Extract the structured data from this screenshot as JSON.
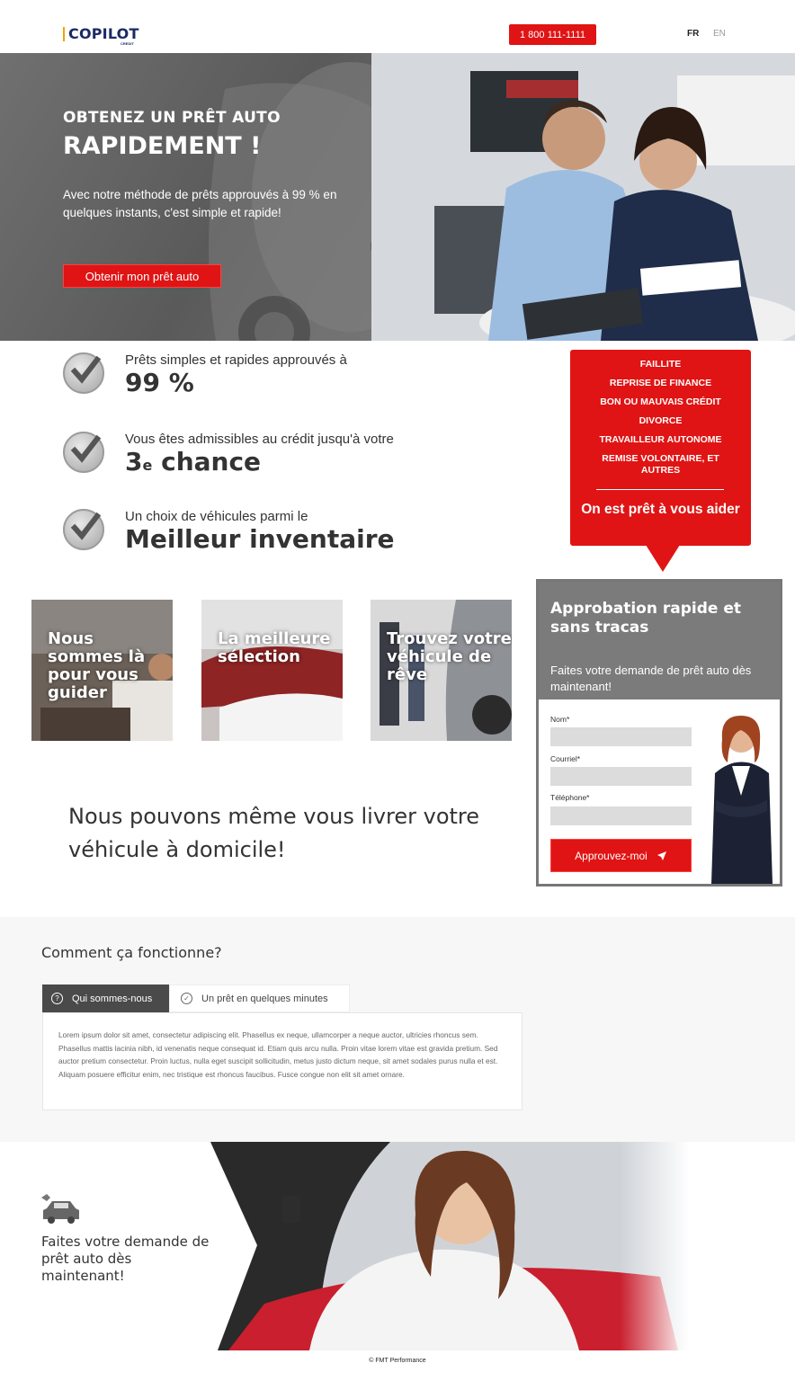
{
  "header": {
    "logo_text": "COPILOT",
    "logo_sub": "CREDIT",
    "phone": "1 800 111-1111",
    "lang_fr": "FR",
    "lang_en": "EN"
  },
  "hero": {
    "kicker": "OBTENEZ UN PRÊT AUTO",
    "title": "RAPIDEMENT !",
    "description": "Avec notre méthode de prêts approuvés à 99 % en quelques instants, c'est simple et rapide!",
    "cta": "Obtenir mon prêt auto"
  },
  "features": [
    {
      "small": "Prêts simples et rapides approuvés à",
      "big": "99 %"
    },
    {
      "small": "Vous êtes admissibles au crédit jusqu'à votre",
      "big_main": "3",
      "big_sup": "e",
      "big_rest": " chance"
    },
    {
      "small": "Un choix de véhicules parmi le",
      "big": "Meilleur inventaire"
    }
  ],
  "situations": {
    "items": [
      "FAILLITE",
      "REPRISE DE FINANCE",
      "BON OU MAUVAIS CRÉDIT",
      "DIVORCE",
      "TRAVAILLEUR AUTONOME",
      "REMISE VOLONTAIRE, ET AUTRES"
    ],
    "help": "On est prêt à vous aider"
  },
  "tiles": [
    {
      "label": "Nous sommes là pour vous guider"
    },
    {
      "label": "La meilleure sélection"
    },
    {
      "label": "Trouvez votre véhicule de rêve"
    }
  ],
  "delivery": "Nous pouvons même vous livrer votre véhicule à domicile!",
  "form": {
    "title": "Approbation rapide et sans tracas",
    "description": "Faites votre demande de prêt auto dès maintenant!",
    "name_label": "Nom*",
    "email_label": "Courriel*",
    "phone_label": "Téléphone*",
    "submit": "Approuvez-moi"
  },
  "how": {
    "title": "Comment ça fonctionne?",
    "tabs": [
      {
        "label": "Qui sommes-nous",
        "icon": "question-circle-icon"
      },
      {
        "label": "Un prêt en quelques minutes",
        "icon": "check-circle-icon"
      }
    ],
    "body": "Lorem ipsum dolor sit amet, consectetur adipiscing elit. Phasellus ex neque, ullamcorper a neque auctor, ultricies rhoncus sem. Phasellus mattis lacinia nibh, id venenatis neque consequat id. Etiam quis arcu nulla. Proin vitae lorem vitae est gravida pretium. Sed auctor pretium consectetur. Proin luctus, nulla eget suscipit sollicitudin, metus justo dictum neque, sit amet sodales purus nulla et est. Aliquam posuere efficitur enim, nec tristique est rhoncus faucibus. Fusce congue non elit sit amet ornare."
  },
  "promo": {
    "text": "Faites votre demande de prêt auto dès maintenant!"
  },
  "footer": "© FMT Performance",
  "colors": {
    "accent": "#e01414",
    "brand": "#1b2a63",
    "panel_gray": "#7b7b7b"
  }
}
